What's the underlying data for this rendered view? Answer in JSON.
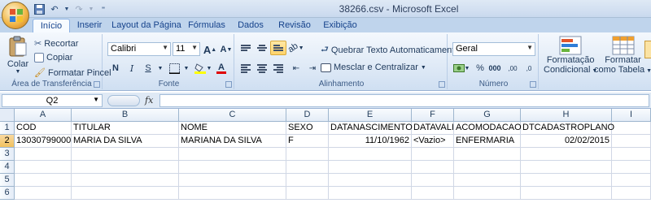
{
  "window": {
    "title": "38266.csv - Microsoft Excel"
  },
  "qat": {
    "save_icon": "save-icon",
    "undo_icon": "undo-icon",
    "redo_icon": "redo-icon"
  },
  "tabs": [
    {
      "label": "Início",
      "active": true
    },
    {
      "label": "Inserir"
    },
    {
      "label": "Layout da Página"
    },
    {
      "label": "Fórmulas"
    },
    {
      "label": "Dados"
    },
    {
      "label": "Revisão"
    },
    {
      "label": "Exibição"
    }
  ],
  "ribbon": {
    "clipboard": {
      "label": "Área de Transferência",
      "paste": "Colar",
      "cut": "Recortar",
      "copy": "Copiar",
      "format_painter": "Formatar Pincel"
    },
    "font": {
      "label": "Fonte",
      "font_name": "Calibri",
      "font_size": "11",
      "bold": "N",
      "italic": "I",
      "underline": "S",
      "grow": "A",
      "shrink": "A",
      "font_color": "A"
    },
    "alignment": {
      "label": "Alinhamento",
      "wrap_text": "Quebrar Texto Automaticamente",
      "merge_center": "Mesclar e Centralizar"
    },
    "number": {
      "label": "Número",
      "format": "Geral",
      "percent": "%",
      "thousands": "000",
      "inc_decimal": ",00",
      "dec_decimal": ",0"
    },
    "styles": {
      "conditional": "Formatação",
      "conditional2": "Condicional",
      "table": "Formatar",
      "table2": "como Tabela"
    }
  },
  "formula_bar": {
    "name_box": "Q2",
    "fx": "fx",
    "content": ""
  },
  "sheet": {
    "columns": [
      "A",
      "B",
      "C",
      "D",
      "E",
      "F",
      "G",
      "H",
      "I"
    ],
    "rows": [
      "1",
      "2",
      "3",
      "4",
      "5",
      "6"
    ],
    "row1": [
      "COD",
      "TITULAR",
      "NOME",
      "SEXO",
      "DATANASCIMENTO",
      "DATAVALI",
      "ACOMODACAO",
      "DTCADASTROPLANO",
      ""
    ],
    "row2": [
      "13030799000",
      "MARIA DA SILVA",
      "MARIANA DA SILVA",
      "F",
      "11/10/1962",
      "<Vazio>",
      "ENFERMARIA",
      "02/02/2015",
      ""
    ]
  },
  "colors": {
    "ribbon_bg": "#dbe7f5",
    "tab_text": "#15428b",
    "header_selected": "#f1c15f"
  }
}
